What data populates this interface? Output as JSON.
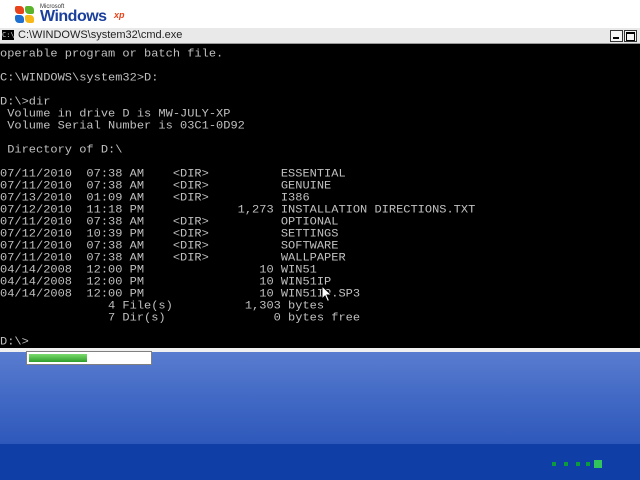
{
  "boot": {
    "logo_ms": "Microsoft",
    "logo_word": "Windows",
    "logo_sup": "xp"
  },
  "window": {
    "title": "C:\\WINDOWS\\system32\\cmd.exe",
    "icon": "console-icon",
    "buttons": [
      "minimize",
      "maximize"
    ]
  },
  "console": {
    "lines": [
      "operable program or batch file.",
      "",
      "C:\\WINDOWS\\system32>D:",
      "",
      "D:\\>dir",
      " Volume in drive D is MW-JULY-XP",
      " Volume Serial Number is 03C1-0D92",
      "",
      " Directory of D:\\",
      "",
      "07/11/2010  07:38 AM    <DIR>          ESSENTIAL",
      "07/11/2010  07:38 AM    <DIR>          GENUINE",
      "07/13/2010  01:09 AM    <DIR>          I386",
      "07/12/2010  11:18 PM             1,273 INSTALLATION DIRECTIONS.TXT",
      "07/11/2010  07:38 AM    <DIR>          OPTIONAL",
      "07/12/2010  10:39 PM    <DIR>          SETTINGS",
      "07/11/2010  07:38 AM    <DIR>          SOFTWARE",
      "07/11/2010  07:38 AM    <DIR>          WALLPAPER",
      "04/14/2008  12:00 PM                10 WIN51",
      "04/14/2008  12:00 PM                10 WIN51IP",
      "04/14/2008  12:00 PM                10 WIN51IP.SP3",
      "               4 File(s)          1,303 bytes",
      "               7 Dir(s)               0 bytes free",
      "",
      "D:\\>"
    ]
  },
  "progress": {
    "fraction": 0.48,
    "color": "#2f9e2a"
  },
  "colors": {
    "console_bg": "#000000",
    "console_text": "#c0c0c0",
    "desktop": "#4068c4"
  }
}
